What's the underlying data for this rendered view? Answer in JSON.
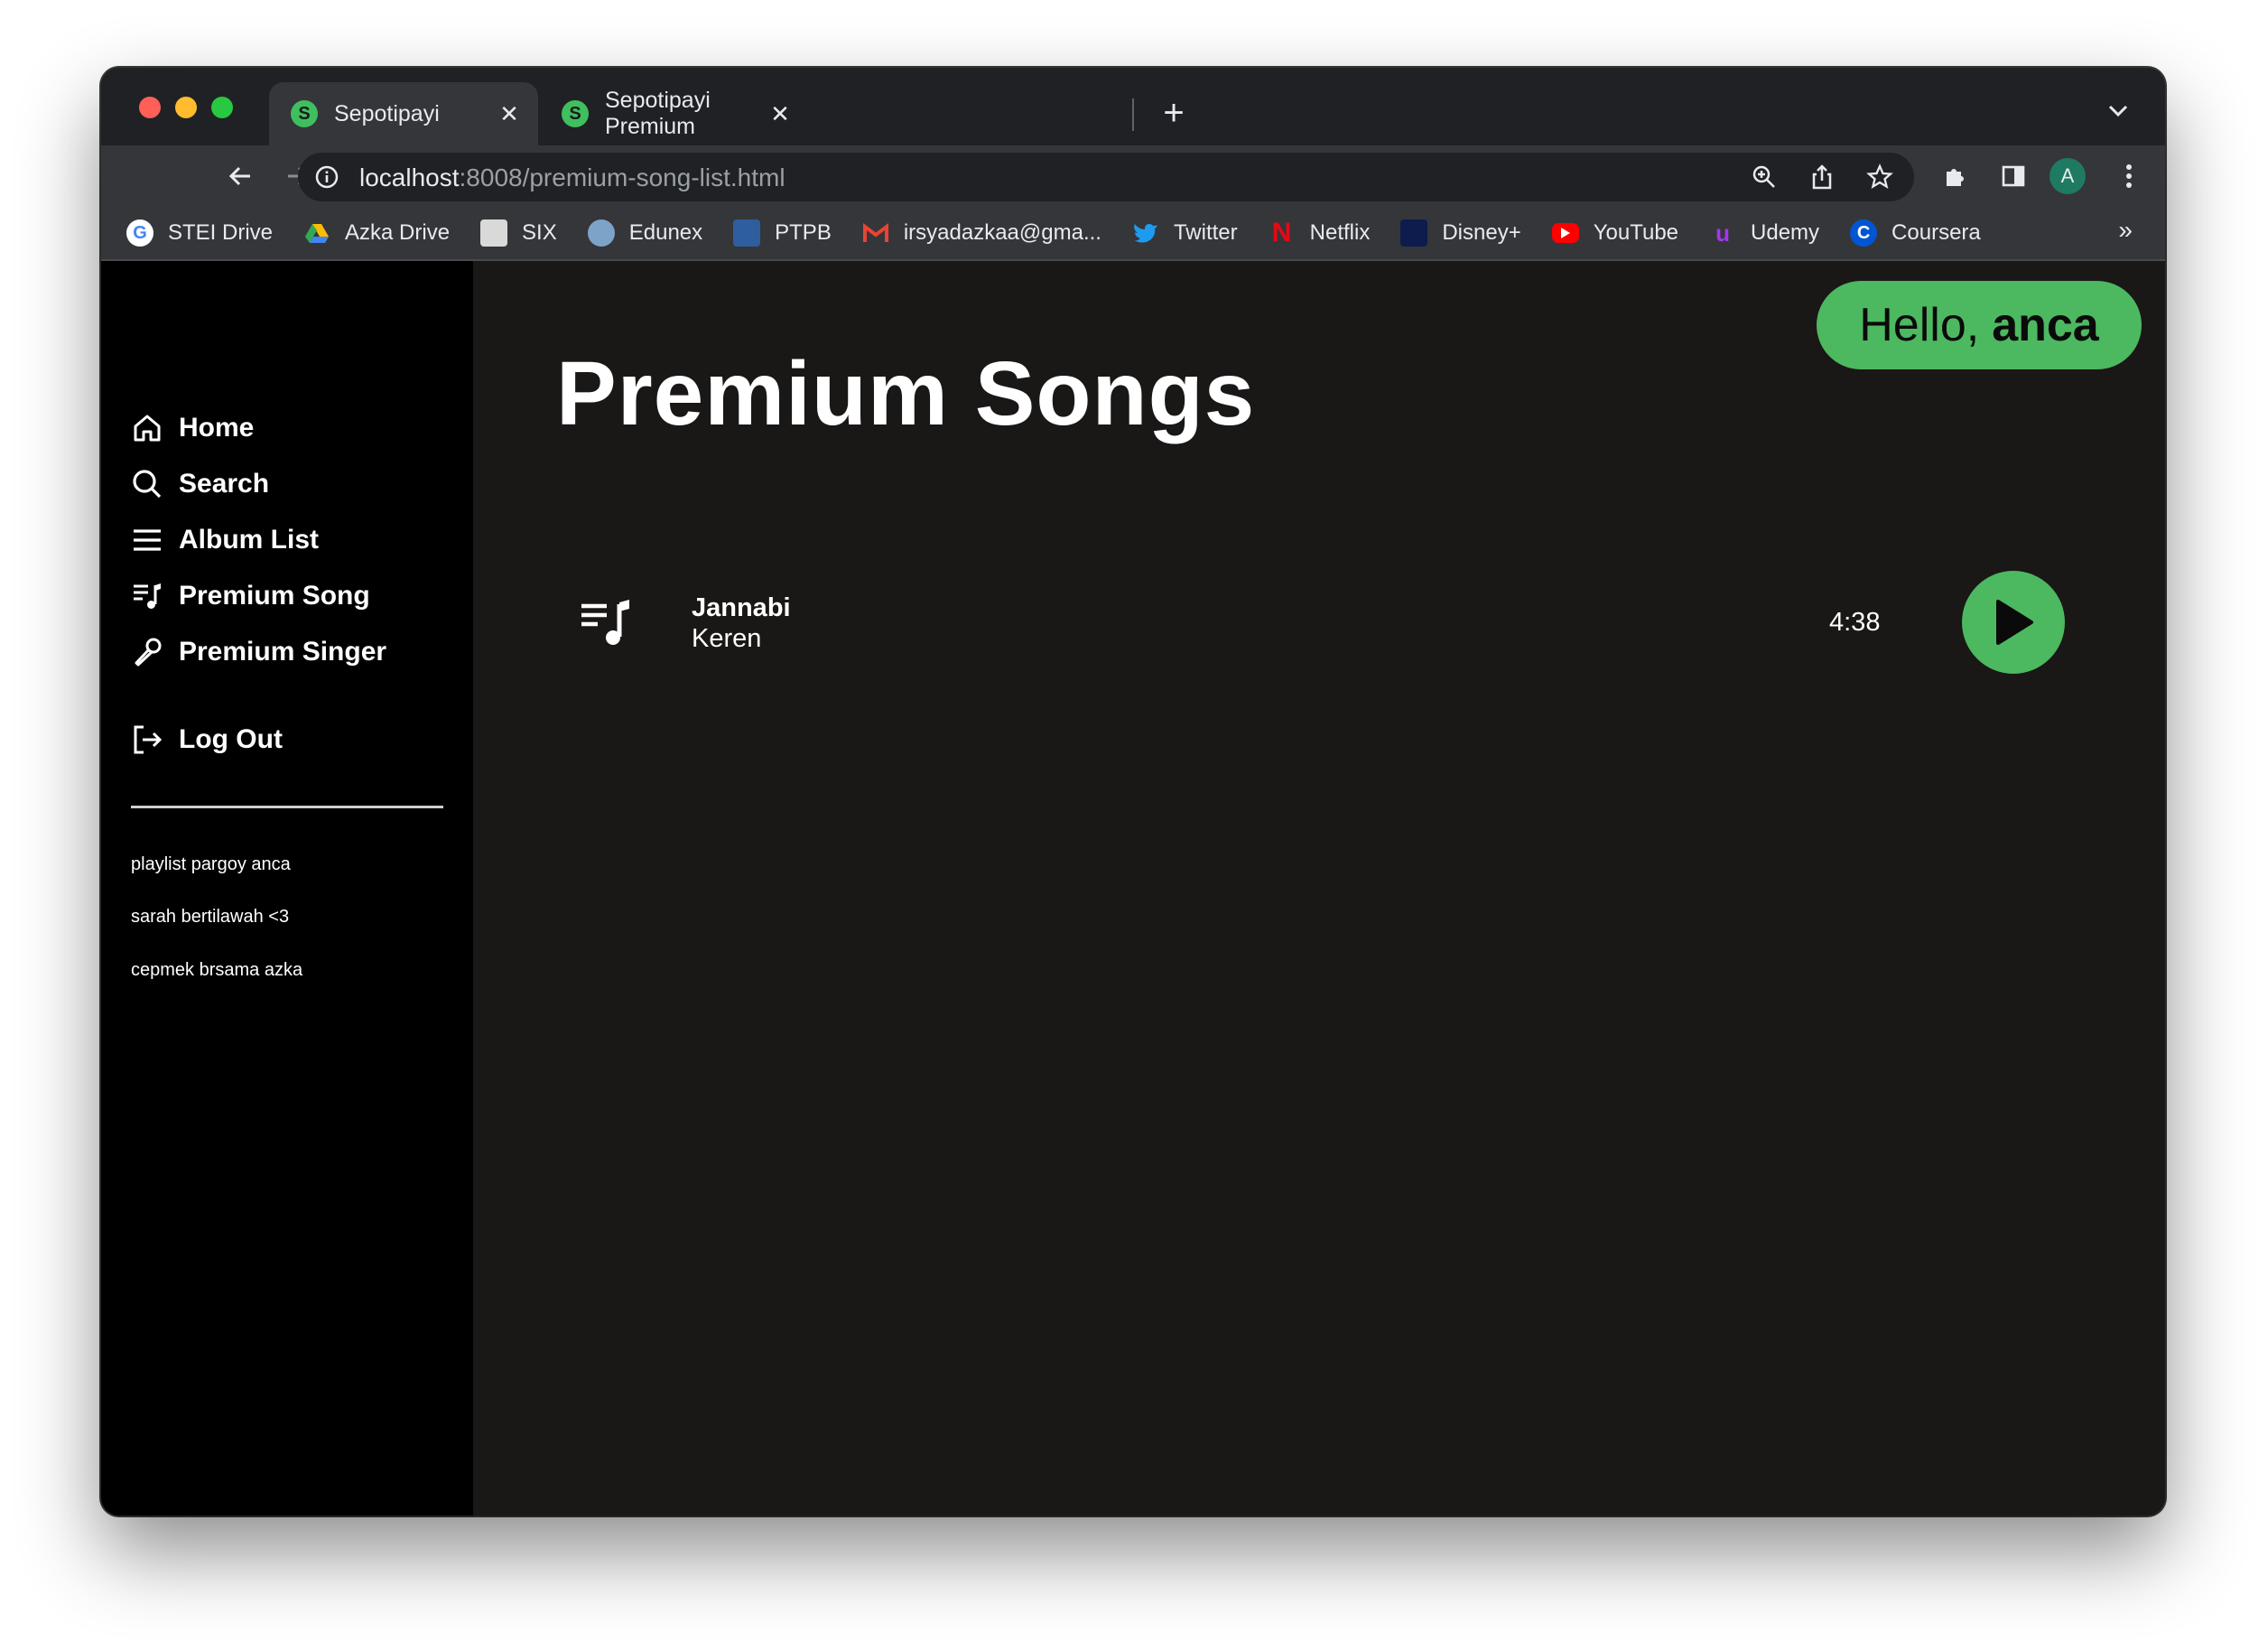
{
  "browser": {
    "tabs": [
      {
        "title": "Sepotipayi",
        "favicon": "S"
      },
      {
        "title": "Sepotipayi Premium",
        "favicon": "S"
      }
    ],
    "url_host": "localhost",
    "url_rest": ":8008/premium-song-list.html",
    "avatar_letter": "A",
    "bookmarks": [
      {
        "label": "STEI Drive",
        "icon": "google-icon"
      },
      {
        "label": "Azka Drive",
        "icon": "drive-icon"
      },
      {
        "label": "SIX",
        "icon": "six-icon"
      },
      {
        "label": "Edunex",
        "icon": "edunex-icon"
      },
      {
        "label": "PTPB",
        "icon": "ptpb-icon"
      },
      {
        "label": "irsyadazkaa@gma...",
        "icon": "gmail-icon"
      },
      {
        "label": "Twitter",
        "icon": "twitter-icon"
      },
      {
        "label": "Netflix",
        "icon": "netflix-icon"
      },
      {
        "label": "Disney+",
        "icon": "disney-icon"
      },
      {
        "label": "YouTube",
        "icon": "youtube-icon"
      },
      {
        "label": "Udemy",
        "icon": "udemy-icon"
      },
      {
        "label": "Coursera",
        "icon": "coursera-icon"
      }
    ],
    "bookmarks_overflow": "»"
  },
  "sidebar": {
    "nav": [
      {
        "label": "Home",
        "icon": "home-icon"
      },
      {
        "label": "Search",
        "icon": "search-icon"
      },
      {
        "label": "Album List",
        "icon": "list-icon"
      },
      {
        "label": "Premium Song",
        "icon": "playlist-music-icon"
      },
      {
        "label": "Premium Singer",
        "icon": "microphone-icon"
      }
    ],
    "logout": "Log Out",
    "playlists": [
      "playlist pargoy anca",
      "sarah bertilawah <3",
      "cepmek brsama azka"
    ]
  },
  "header": {
    "greeting": "Hello,",
    "username": "anca"
  },
  "main": {
    "title": "Premium Songs",
    "songs": [
      {
        "title": "Jannabi",
        "artist": "Keren",
        "duration": "4:38"
      }
    ]
  },
  "colors": {
    "accent": "#4cb860",
    "sidebar_bg": "#000000",
    "main_bg": "#1a1717"
  }
}
